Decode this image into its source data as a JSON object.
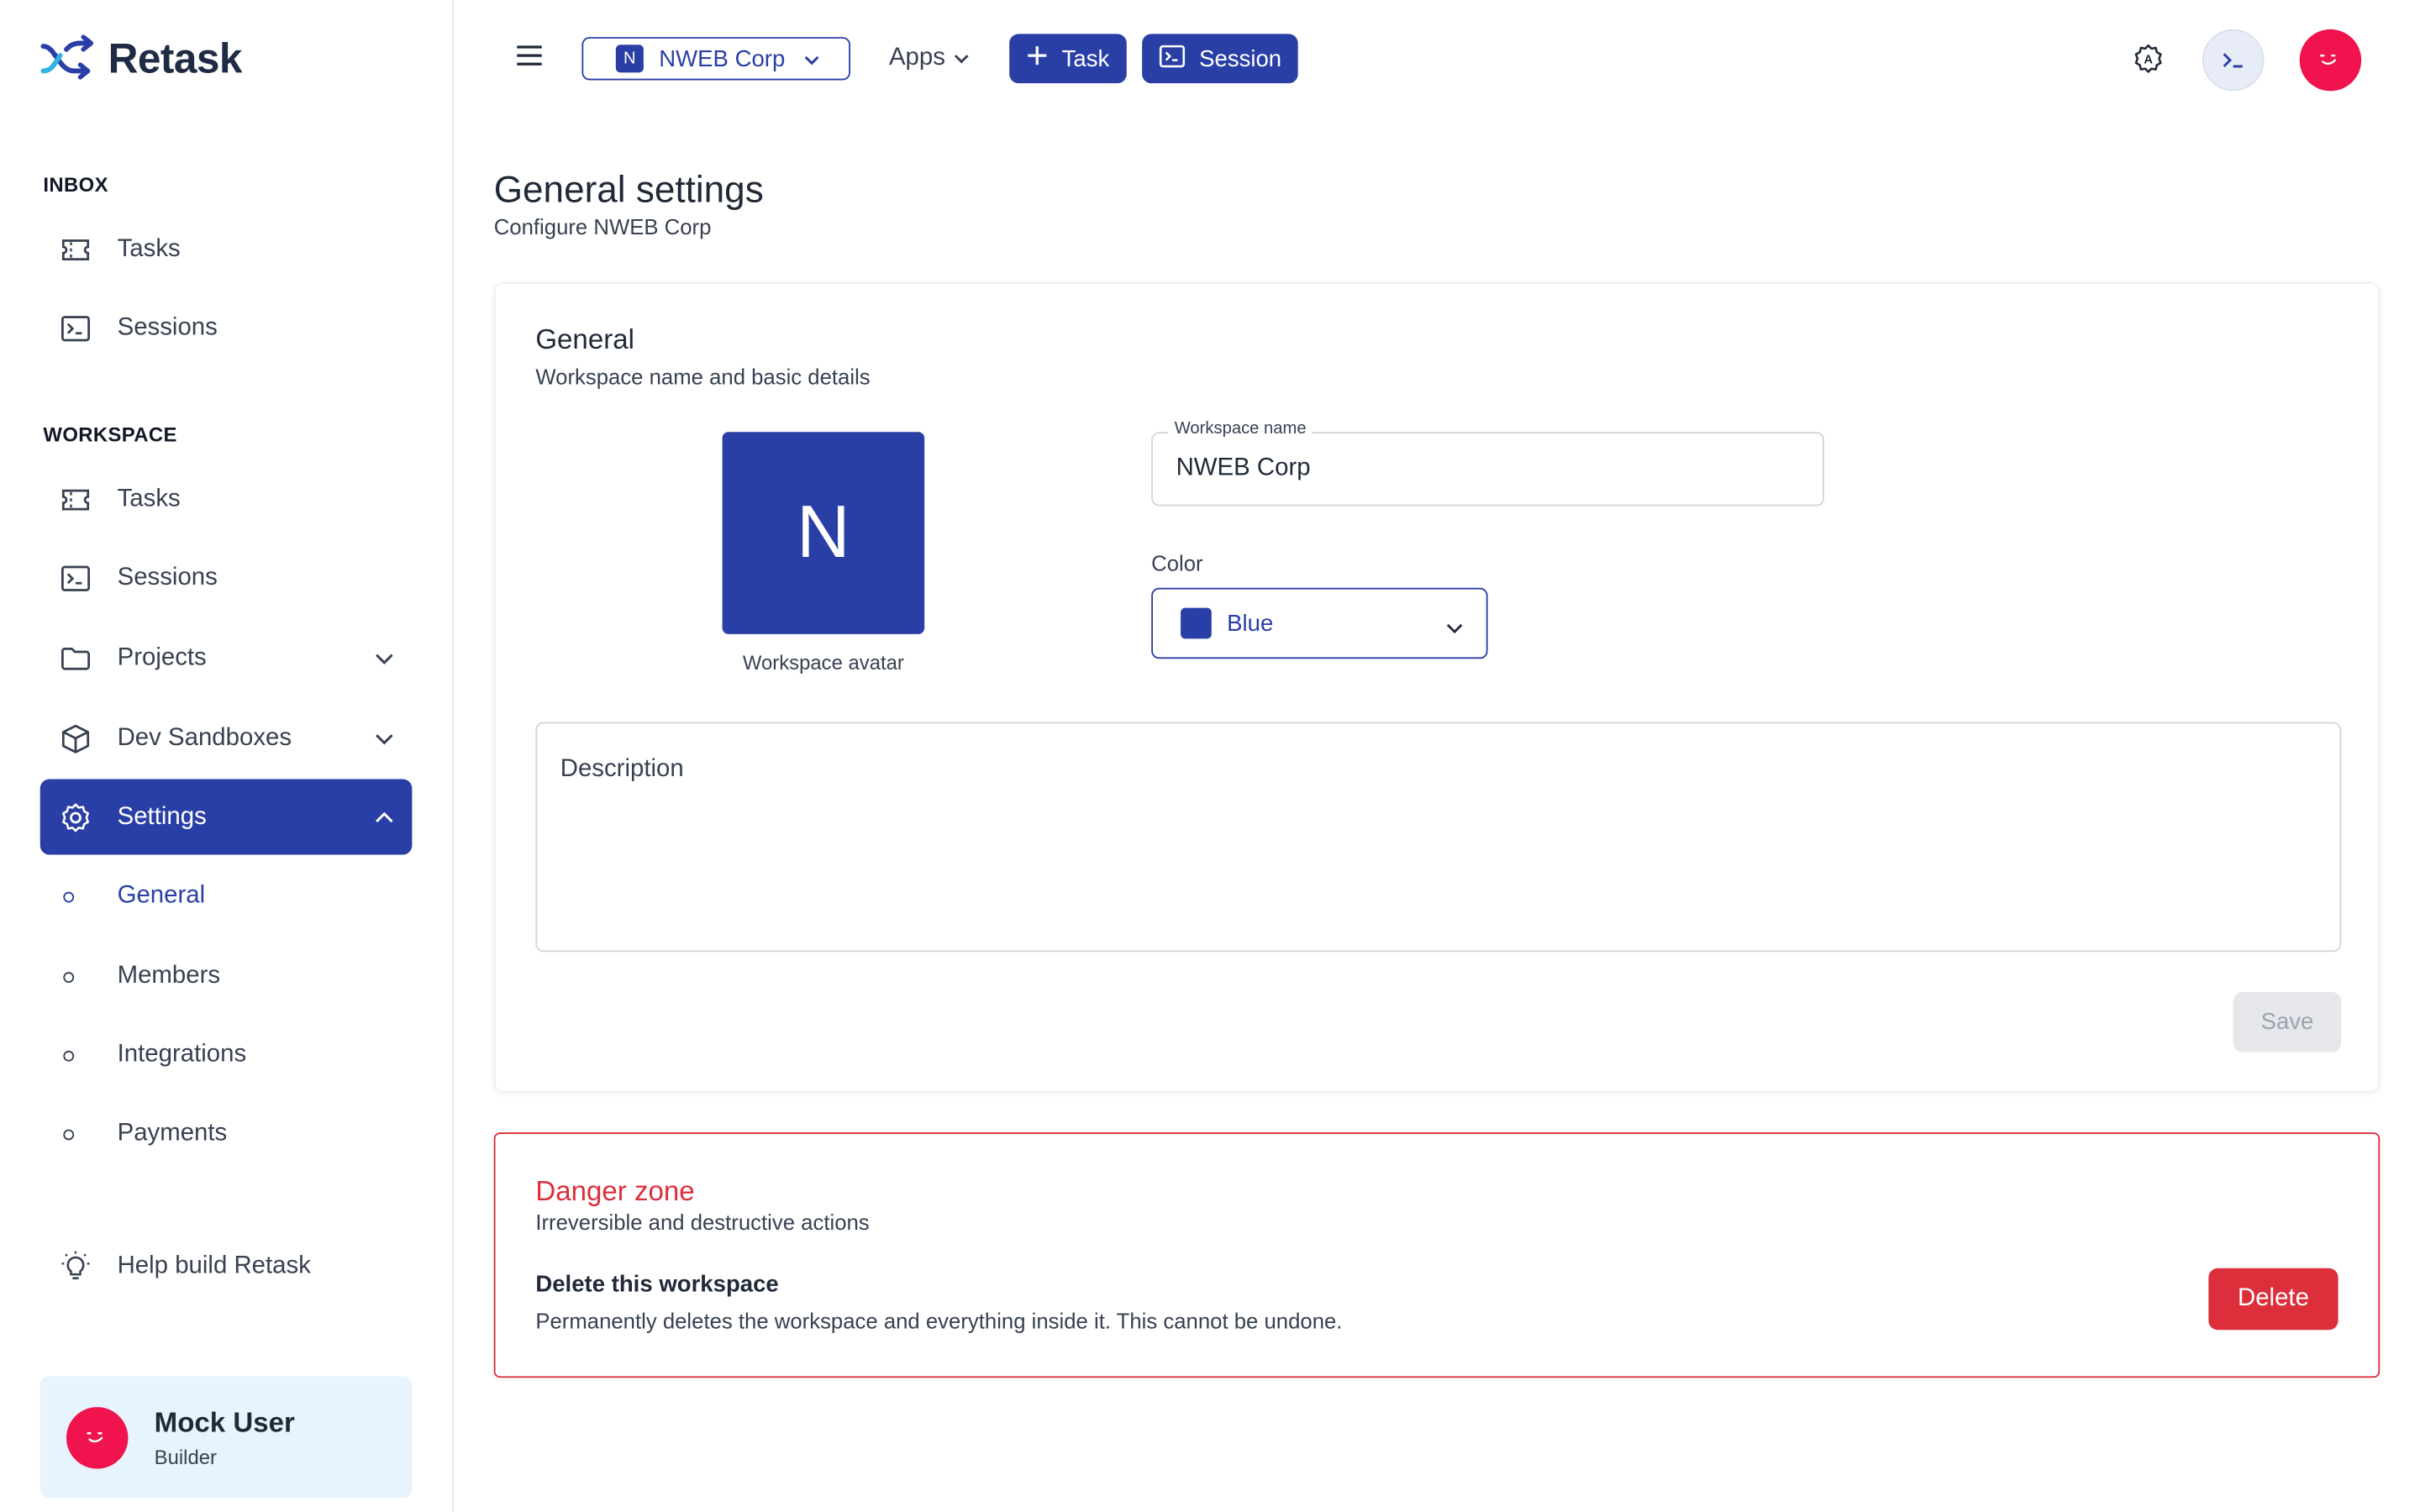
{
  "app": {
    "name": "Retask"
  },
  "sidebar": {
    "inbox_label": "INBOX",
    "inbox_items": [
      {
        "label": "Tasks",
        "icon": "ticket-icon"
      },
      {
        "label": "Sessions",
        "icon": "terminal-icon"
      }
    ],
    "workspace_label": "WORKSPACE",
    "workspace_items": [
      {
        "label": "Tasks",
        "icon": "ticket-icon"
      },
      {
        "label": "Sessions",
        "icon": "terminal-icon"
      },
      {
        "label": "Projects",
        "icon": "folder-icon",
        "expandable": true
      },
      {
        "label": "Dev Sandboxes",
        "icon": "cube-icon",
        "expandable": true
      },
      {
        "label": "Settings",
        "icon": "gear-icon",
        "expanded": true,
        "active": true
      }
    ],
    "settings_subitems": [
      {
        "label": "General",
        "current": true
      },
      {
        "label": "Members"
      },
      {
        "label": "Integrations"
      },
      {
        "label": "Payments"
      }
    ],
    "help_label": "Help build Retask",
    "user": {
      "name": "Mock User",
      "role": "Builder"
    }
  },
  "topbar": {
    "workspace": {
      "badge": "N",
      "name": "NWEB Corp"
    },
    "apps_label": "Apps",
    "task_button": "Task",
    "session_button": "Session"
  },
  "page": {
    "title": "General settings",
    "subtitle": "Configure NWEB Corp"
  },
  "general": {
    "title": "General",
    "subtitle": "Workspace name and basic details",
    "avatar_letter": "N",
    "avatar_label": "Workspace avatar",
    "name_label": "Workspace name",
    "name_value": "NWEB Corp",
    "color_label": "Color",
    "color_value": "Blue",
    "description_placeholder": "Description",
    "save_label": "Save"
  },
  "danger": {
    "title": "Danger zone",
    "subtitle": "Irreversible and destructive actions",
    "delete_title": "Delete this workspace",
    "delete_desc": "Permanently deletes the workspace and everything inside it. This cannot be undone.",
    "delete_button": "Delete"
  },
  "colors": {
    "primary": "#2a3fa6",
    "danger": "#dc2f3b",
    "avatar": "#f0134d",
    "user_card_bg": "#e8f4fd"
  }
}
